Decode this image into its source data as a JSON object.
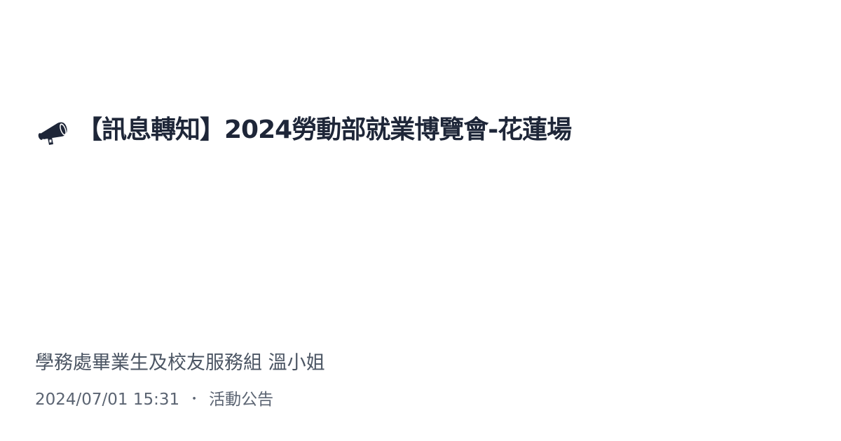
{
  "post": {
    "icon": "megaphone-icon",
    "title": "【訊息轉知】2024勞動部就業博覽會-花蓮場",
    "author": "學務處畢業生及校友服務組 溫小姐",
    "timestamp": "2024/07/01 15:31",
    "separator": "・",
    "category": "活動公告"
  },
  "colors": {
    "title": "#1e2638",
    "text": "#4b5563",
    "icon": "#1e2638"
  }
}
